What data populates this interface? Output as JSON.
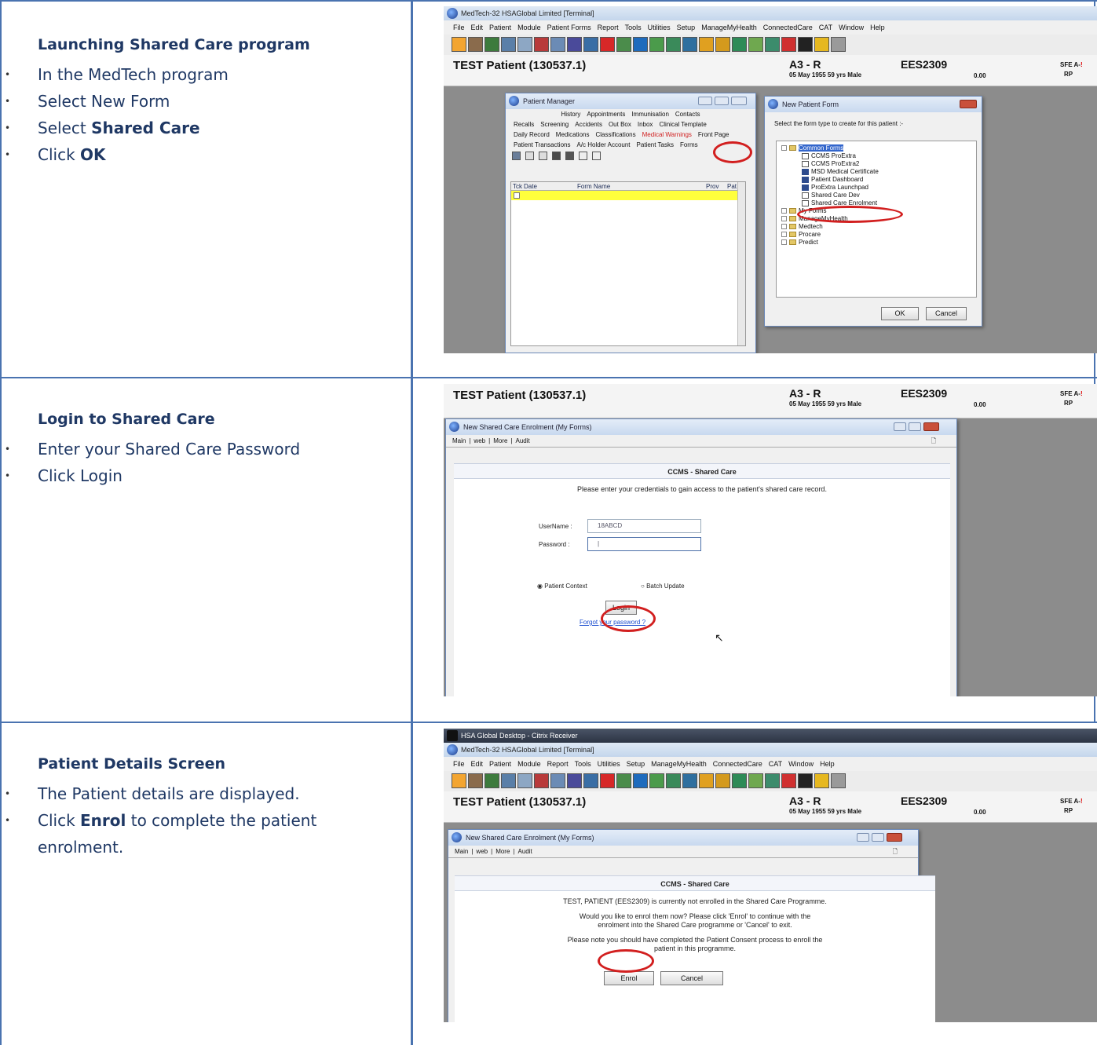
{
  "steps": [
    {
      "title": "Launching Shared Care program",
      "lines": [
        {
          "pre": "In the MedTech program",
          "bold": "",
          "post": ""
        },
        {
          "pre": "Select New Form",
          "bold": "",
          "post": ""
        },
        {
          "pre": "Select ",
          "bold": "Shared Care",
          "post": ""
        },
        {
          "pre": "Click ",
          "bold": "OK",
          "post": ""
        }
      ]
    },
    {
      "title": "Login to Shared Care",
      "lines": [
        {
          "pre": "Enter your Shared Care Password",
          "bold": "",
          "post": ""
        },
        {
          "pre": "Click Login",
          "bold": "",
          "post": ""
        }
      ]
    },
    {
      "title": "Patient Details Screen",
      "lines": [
        {
          "pre": "The Patient details are displayed.",
          "bold": "",
          "post": ""
        },
        {
          "pre": "Click ",
          "bold": "Enrol",
          "post": " to complete the patient"
        },
        {
          "pre": "enrolment.",
          "bold": "",
          "post": "",
          "nobullet": true
        }
      ]
    }
  ],
  "app": {
    "window_title": "MedTech-32  HSAGlobal Limited  [Terminal]",
    "citrix_title": "HSA Global Desktop - Citrix Receiver",
    "menu1": [
      "File",
      "Edit",
      "Patient",
      "Module",
      "Patient Forms",
      "Report",
      "Tools",
      "Utilities",
      "Setup",
      "ManageMyHealth",
      "ConnectedCare",
      "CAT",
      "Window",
      "Help"
    ],
    "menu3": [
      "File",
      "Edit",
      "Patient",
      "Module",
      "Report",
      "Tools",
      "Utilities",
      "Setup",
      "ManageMyHealth",
      "ConnectedCare",
      "CAT",
      "Window",
      "Help"
    ],
    "toolbar_colors": [
      "#f3a531",
      "#8a6b4c",
      "#3d7b3d",
      "#5a7fa8",
      "#8da7c4",
      "#b83a3a",
      "#6b8bb5",
      "#4a4a9a",
      "#3a6ea5",
      "#d72828",
      "#4b8c4b",
      "#1e6bbd",
      "#4b9b4b",
      "#3a8a5a",
      "#2f6f9f",
      "#e0a020",
      "#d49a1d",
      "#2e8b57",
      "#6fa84f",
      "#3c8c6c",
      "#d03030",
      "#222222",
      "#e6b820",
      "#9a9a9a"
    ]
  },
  "patient": {
    "name": "TEST Patient (130537.1)",
    "age_code": "A3 - R",
    "dob_line": "05 May 1955 59 yrs    Male",
    "nhi": "EES2309",
    "balance": "0.00",
    "sfe": "SFE A-",
    "sfe_warn": "!",
    "rp": "RP"
  },
  "patient_manager": {
    "title": "Patient Manager",
    "tabs_row1": [
      "History",
      "Appointments",
      "Immunisation",
      "Contacts"
    ],
    "tabs_row2": [
      "Recalls",
      "Screening",
      "Accidents",
      "Out Box",
      "Inbox",
      "Clinical Template"
    ],
    "tabs_row3": [
      "Daily Record",
      "Medications",
      "Classifications",
      "Medical Warnings",
      "Front Page"
    ],
    "tabs_row4": [
      "Patient Transactions",
      "A/c Holder Account",
      "Patient Tasks",
      "Forms"
    ],
    "columns": [
      "Tck",
      "Date",
      "Form Name",
      "Prov",
      "Pat"
    ]
  },
  "new_form": {
    "title": "New Patient Form",
    "prompt": "Select the form type to create for this patient :-",
    "tree": [
      {
        "label": "Common Forms",
        "level": 0,
        "kind": "folder",
        "selected": true
      },
      {
        "label": "CCMS ProExtra",
        "level": 1,
        "kind": "form"
      },
      {
        "label": "CCMS ProExtra2",
        "level": 1,
        "kind": "form"
      },
      {
        "label": "MSD Medical Certificate",
        "level": 1,
        "kind": "doc"
      },
      {
        "label": "Patient Dashboard",
        "level": 1,
        "kind": "doc"
      },
      {
        "label": "ProExtra Launchpad",
        "level": 1,
        "kind": "doc"
      },
      {
        "label": "Shared Care Dev",
        "level": 1,
        "kind": "form"
      },
      {
        "label": "Shared Care Enrolment",
        "level": 1,
        "kind": "form"
      },
      {
        "label": "My Forms",
        "level": 0,
        "kind": "folder"
      },
      {
        "label": "ManageMyHealth",
        "level": 0,
        "kind": "folder"
      },
      {
        "label": "Medtech",
        "level": 0,
        "kind": "folder"
      },
      {
        "label": "Procare",
        "level": 0,
        "kind": "folder"
      },
      {
        "label": "Predict",
        "level": 0,
        "kind": "folder"
      }
    ],
    "ok": "OK",
    "cancel": "Cancel"
  },
  "enrol_window": {
    "title": "New Shared Care Enrolment (My Forms)",
    "tabs": [
      "Main",
      "web",
      "More",
      "Audit"
    ],
    "ccms_title": "CCMS - Shared Care"
  },
  "login": {
    "prompt": "Please enter your credentials to gain access to the patient's shared care record.",
    "username_label": "UserName :",
    "username_value": "18ABCD",
    "password_label": "Password :",
    "patient_context": "Patient Context",
    "batch_update": "Batch Update",
    "login_button": "Login",
    "forgot": "Forgot your password ?"
  },
  "enrol": {
    "line1": "TEST, PATIENT (EES2309) is currently not enrolled in the Shared Care Programme.",
    "line2": "Would you like to enrol them now? Please click 'Enrol' to continue with the",
    "line3": "enrolment into the Shared Care programme or 'Cancel' to exit.",
    "line4": "Please note you should have completed the Patient Consent process to enroll the",
    "line5": "patient in this programme.",
    "enrol_button": "Enrol",
    "cancel_button": "Cancel"
  }
}
